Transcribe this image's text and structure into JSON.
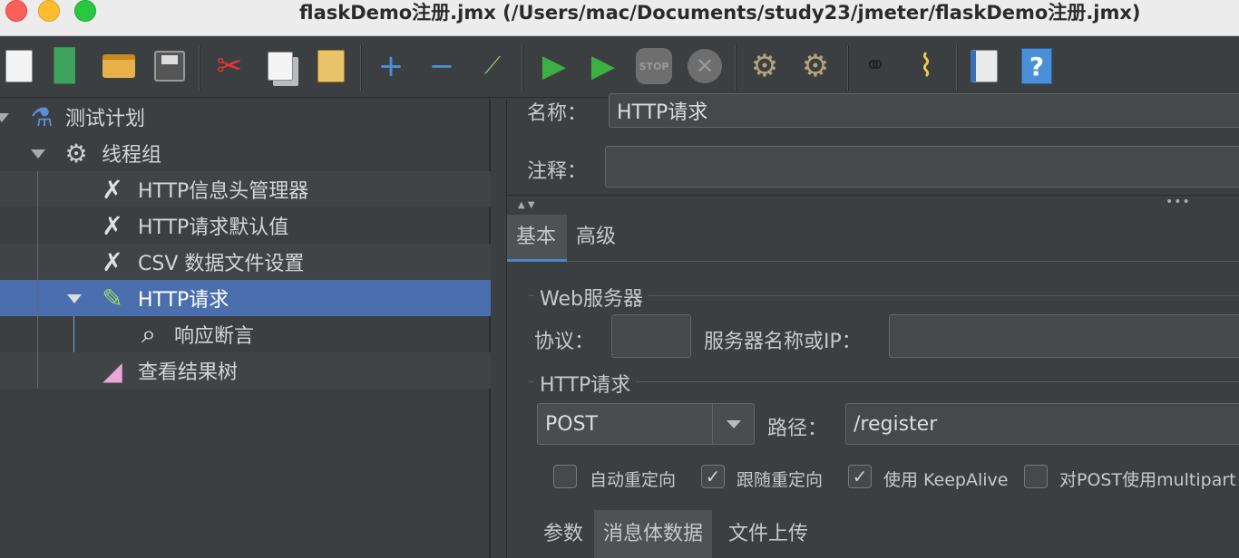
{
  "window": {
    "title": "flaskDemo注册.jmx (/Users/mac/Documents/study23/jmeter/flaskDemo注册.jmx)"
  },
  "toolbar": {
    "buttons": [
      {
        "name": "new-icon"
      },
      {
        "name": "templates-icon"
      },
      {
        "name": "open-icon"
      },
      {
        "name": "save-icon"
      },
      {
        "name": "cut-icon"
      },
      {
        "name": "copy-icon"
      },
      {
        "name": "paste-icon"
      },
      {
        "name": "expand-icon"
      },
      {
        "name": "collapse-icon"
      },
      {
        "name": "toggle-icon"
      },
      {
        "name": "start-icon"
      },
      {
        "name": "start-no-pause-icon"
      },
      {
        "name": "stop-icon"
      },
      {
        "name": "shutdown-icon"
      },
      {
        "name": "clear-icon"
      },
      {
        "name": "clear-all-icon"
      },
      {
        "name": "search-icon"
      },
      {
        "name": "reset-search-icon"
      },
      {
        "name": "function-helper-icon"
      },
      {
        "name": "help-icon"
      }
    ]
  },
  "tree": {
    "items": [
      {
        "label": "测试计划",
        "icon": "test-plan-icon"
      },
      {
        "label": "线程组",
        "icon": "gear-icon"
      },
      {
        "label": "HTTP信息头管理器",
        "icon": "config-tools-icon"
      },
      {
        "label": "HTTP请求默认值",
        "icon": "config-tools-icon"
      },
      {
        "label": "CSV 数据文件设置",
        "icon": "config-tools-icon"
      },
      {
        "label": "HTTP请求",
        "icon": "sampler-pipette-icon"
      },
      {
        "label": "响应断言",
        "icon": "assertion-magnifier-icon"
      },
      {
        "label": "查看结果树",
        "icon": "listener-icon"
      }
    ]
  },
  "form": {
    "name_label": "名称：",
    "name_value": "HTTP请求",
    "comment_label": "注释：",
    "comment_value": "",
    "tabs": [
      "基本",
      "高级"
    ],
    "web_server_title": "Web服务器",
    "protocol_label": "协议：",
    "protocol_value": "",
    "server_label": "服务器名称或IP：",
    "server_value": "",
    "http_request_title": "HTTP请求",
    "method": "POST",
    "path_label": "路径：",
    "path_value": "/register",
    "checkboxes": [
      {
        "label": "自动重定向",
        "checked": false
      },
      {
        "label": "跟随重定向",
        "checked": true
      },
      {
        "label": "使用 KeepAlive",
        "checked": true
      },
      {
        "label": "对POST使用multipart /",
        "checked": false
      }
    ],
    "bottom_tabs": [
      "参数",
      "消息体数据",
      "文件上传"
    ],
    "checkmark": "✓"
  }
}
